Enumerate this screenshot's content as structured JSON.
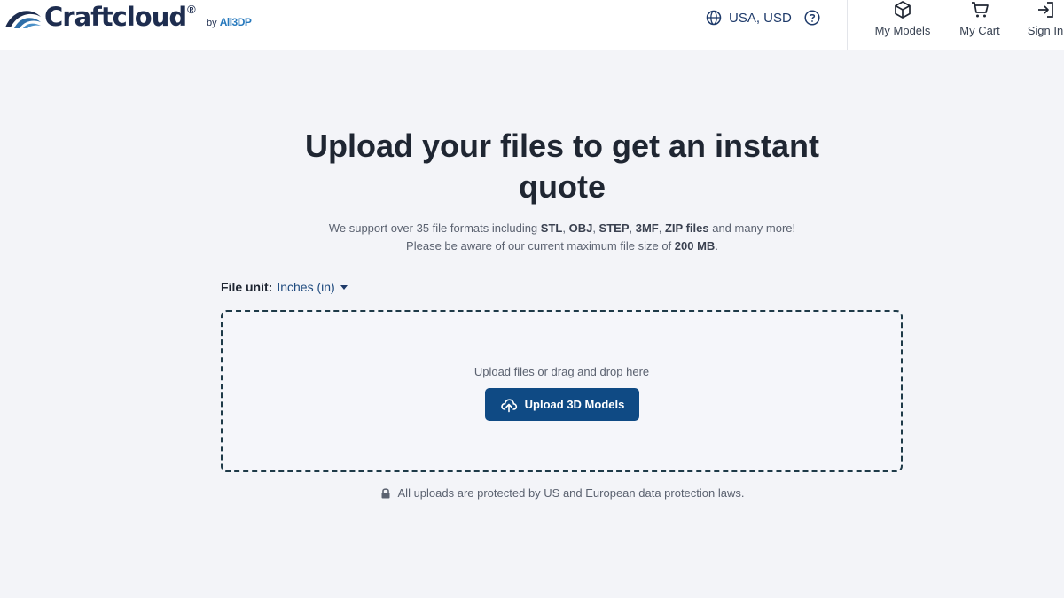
{
  "header": {
    "logo_text": "Craftcloud",
    "logo_reg": "®",
    "logo_by": "by",
    "logo_brand": "All3DP",
    "region_label": "USA, USD",
    "nav": {
      "models_label": "My Models",
      "cart_label": "My Cart",
      "signin_label": "Sign In"
    }
  },
  "main": {
    "title": "Upload your files to get an instant quote",
    "support_line": {
      "prefix": "We support over 35 file formats including ",
      "fmt1": "STL",
      "sep1": ", ",
      "fmt2": "OBJ",
      "sep2": ", ",
      "fmt3": "STEP",
      "sep3": ", ",
      "fmt4": "3MF",
      "sep4": ", ",
      "fmt5": "ZIP files",
      "suffix": " and many more!"
    },
    "size_line": {
      "prefix": "Please be aware of our current maximum file size of ",
      "size": "200 MB",
      "suffix": "."
    },
    "file_unit_label": "File unit:",
    "file_unit_value": "Inches (in)",
    "dropzone_text": "Upload files or drag and drop here",
    "upload_button": "Upload 3D Models",
    "protection_note": "All uploads are protected by US and European data protection laws."
  },
  "colors": {
    "brand_dark": "#1e2d4f",
    "button_bg": "#0f4a84",
    "page_bg": "#f3f4f8"
  },
  "icons": [
    "craftcloud-logo-icon",
    "globe-icon",
    "help-icon",
    "cube-icon",
    "cart-icon",
    "sign-in-icon",
    "upload-cloud-icon",
    "lock-icon"
  ]
}
